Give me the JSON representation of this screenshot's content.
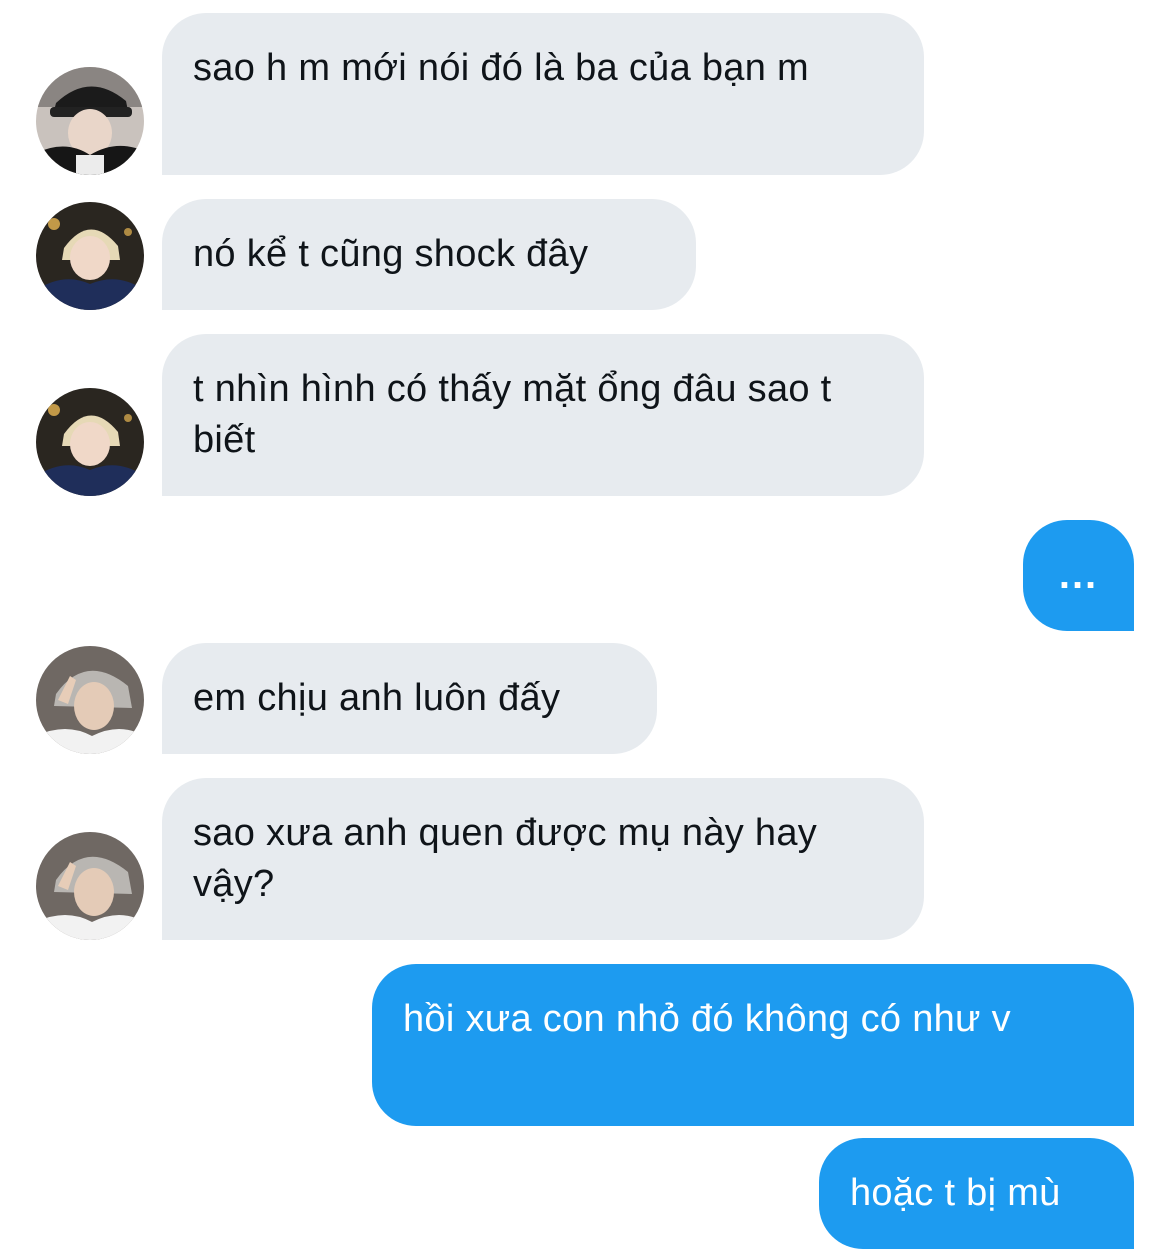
{
  "conversation": {
    "messages": [
      {
        "sender": "participant-1",
        "text": "sao h m mới nói đó là ba của bạn m"
      },
      {
        "sender": "participant-2",
        "text": "nó kể t cũng shock đây"
      },
      {
        "sender": "participant-2",
        "text": "t nhìn hình có thấy mặt ổng đâu sao t biết"
      },
      {
        "sender": "me",
        "text": "..."
      },
      {
        "sender": "participant-3",
        "text": "em chịu anh luôn đấy"
      },
      {
        "sender": "participant-3",
        "text": "sao xưa anh quen được mụ này hay vậy?"
      },
      {
        "sender": "me",
        "text": "hồi xưa con nhỏ đó không có như v"
      },
      {
        "sender": "me",
        "text": "hoặc t bị mù"
      }
    ]
  },
  "colors": {
    "incoming_bubble": "#e7ebef",
    "outgoing_bubble": "#1d9bf0",
    "incoming_text": "#0f1419",
    "outgoing_text": "#ffffff"
  }
}
